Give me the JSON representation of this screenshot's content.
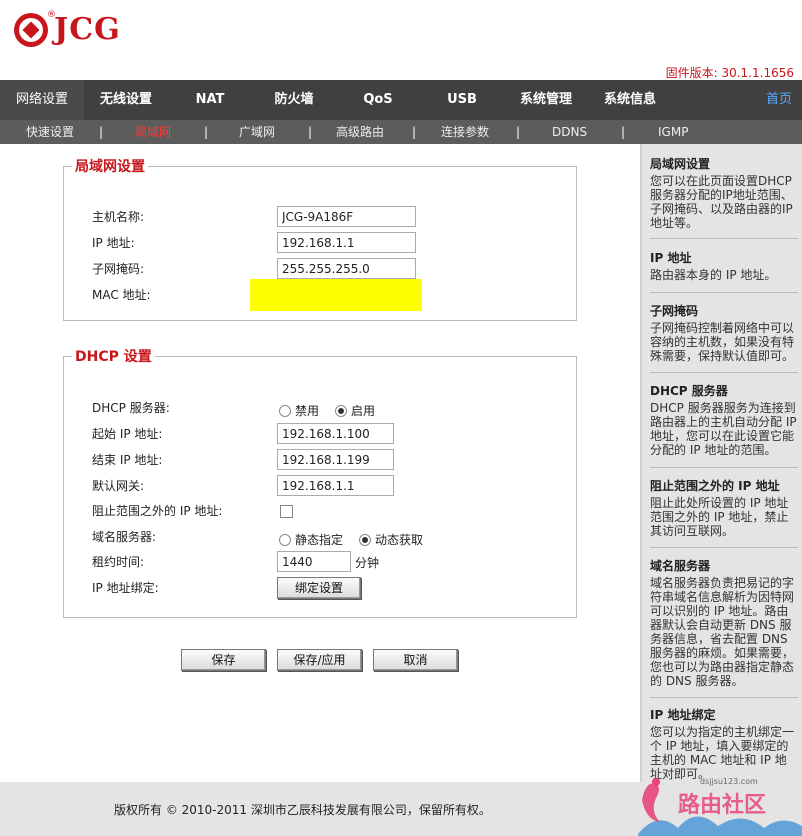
{
  "brand": {
    "name": "JCG",
    "reg": "®"
  },
  "firmware": "固件版本: 30.1.1.1656",
  "mainnav": {
    "tabs": [
      "网络设置",
      "无线设置",
      "NAT",
      "防火墙",
      "QoS",
      "USB",
      "系统管理",
      "系统信息"
    ],
    "active": 0,
    "home": "首页"
  },
  "subnav": {
    "items": [
      "快速设置",
      "局域网",
      "广域网",
      "高级路由",
      "连接参数",
      "DDNS",
      "IGMP"
    ],
    "active": 1,
    "separator": "|"
  },
  "lan": {
    "legend": "局域网设置",
    "hostname_label": "主机名称:",
    "hostname_value": "JCG-9A186F",
    "ip_label": "IP 地址:",
    "ip_value": "192.168.1.1",
    "mask_label": "子网掩码:",
    "mask_value": "255.255.255.0",
    "mac_label": "MAC 地址:"
  },
  "dhcp": {
    "legend": "DHCP 设置",
    "server_label": "DHCP 服务器:",
    "server_options": [
      "禁用",
      "启用"
    ],
    "server_selected": 1,
    "start_label": "起始 IP 地址:",
    "start_value": "192.168.1.100",
    "end_label": "结束 IP 地址:",
    "end_value": "192.168.1.199",
    "gateway_label": "默认网关:",
    "gateway_value": "192.168.1.1",
    "block_label": "阻止范围之外的 IP 地址:",
    "block_checked": false,
    "dns_label": "域名服务器:",
    "dns_options": [
      "静态指定",
      "动态获取"
    ],
    "dns_selected": 1,
    "lease_label": "租约时间:",
    "lease_value": "1440",
    "lease_unit": "分钟",
    "bind_label": "IP 地址绑定:",
    "bind_button": "绑定设置"
  },
  "buttons": {
    "save": "保存",
    "save_apply": "保存/应用",
    "cancel": "取消"
  },
  "help": [
    {
      "title": "局域网设置",
      "text": "您可以在此页面设置DHCP服务器分配的IP地址范围、子网掩码、以及路由器的IP地址等。"
    },
    {
      "title": "IP 地址",
      "text": "路由器本身的 IP 地址。"
    },
    {
      "title": "子网掩码",
      "text": "子网掩码控制着网络中可以容纳的主机数，如果没有特殊需要，保持默认值即可。"
    },
    {
      "title": "DHCP 服务器",
      "text": "DHCP 服务器服务为连接到路由器上的主机自动分配 IP 地址，您可以在此设置它能分配的 IP 地址的范围。"
    },
    {
      "title": "阻止范围之外的 IP 地址",
      "text": "阻止此处所设置的 IP 地址范围之外的 IP 地址，禁止其访问互联网。"
    },
    {
      "title": "域名服务器",
      "text": "域名服务器负责把易记的字符串域名信息解析为因特网可以识别的 IP 地址。路由器默认会自动更新 DNS 服务器信息，省去配置 DNS 服务器的麻烦。如果需要，您也可以为路由器指定静态的 DNS 服务器。"
    },
    {
      "title": "IP 地址绑定",
      "text": "您可以为指定的主机绑定一个 IP 地址，填入要绑定的主机的 MAC 地址和 IP 地址对即可。"
    }
  ],
  "footer": {
    "copyright": "版权所有 © 2010-2011 深圳市乙辰科技发展有限公司，保留所有权。"
  },
  "watermark": {
    "site": "dsjjsu123.com",
    "name": "路由社区"
  },
  "colors": {
    "brand_red": "#c8161d",
    "nav_bg": "#404040",
    "subnav_bg": "#5c5c5c",
    "help_bg": "#e4e4e4",
    "highlight": "#ffff00",
    "home_link": "#5aa8ff"
  }
}
